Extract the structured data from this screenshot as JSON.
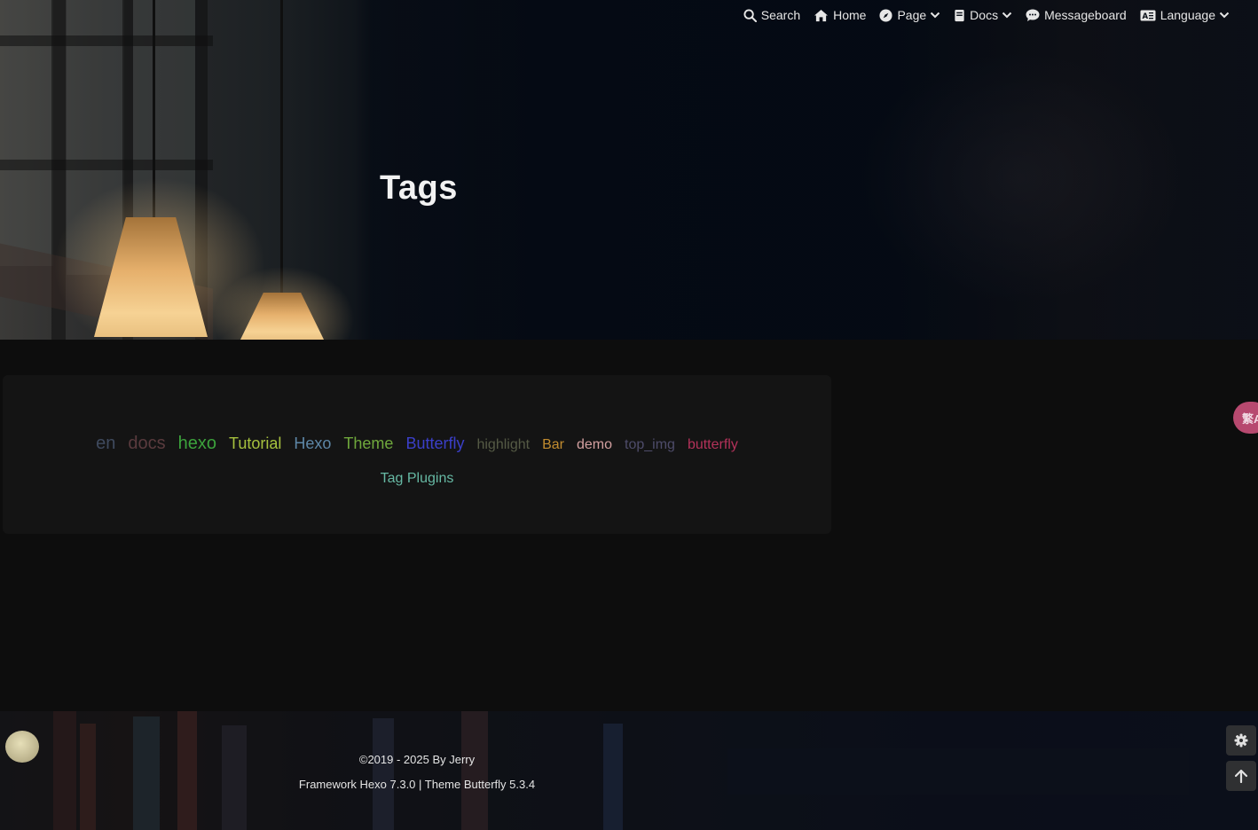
{
  "nav": {
    "items": [
      {
        "label": "Search",
        "icon": "search-icon"
      },
      {
        "label": "Home",
        "icon": "home-icon"
      },
      {
        "label": "Page",
        "icon": "compass-icon"
      },
      {
        "label": "Docs",
        "icon": "book-icon"
      },
      {
        "label": "Messageboard",
        "icon": "comment-icon"
      },
      {
        "label": "Language",
        "icon": "language-icon"
      }
    ]
  },
  "header": {
    "title": "Tags"
  },
  "tags": [
    {
      "label": "en",
      "color": "#3f4a5e"
    },
    {
      "label": "docs",
      "color": "#5a3b3e"
    },
    {
      "label": "hexo",
      "color": "#3ca23c"
    },
    {
      "label": "Tutorial",
      "color": "#a6c13e"
    },
    {
      "label": "Hexo",
      "color": "#5d86a6"
    },
    {
      "label": "Theme",
      "color": "#6fa83c"
    },
    {
      "label": "Butterfly",
      "color": "#3b3fc9"
    },
    {
      "label": "highlight",
      "color": "#555a45"
    },
    {
      "label": "Bar",
      "color": "#c28c2f"
    },
    {
      "label": "demo",
      "color": "#d3a0a0"
    },
    {
      "label": "top_img",
      "color": "#4e4c6a"
    },
    {
      "label": "butterfly",
      "color": "#b3325a"
    },
    {
      "label": "Tag Plugins",
      "color": "#66b8a3"
    }
  ],
  "translate_button": {
    "label": "繁A"
  },
  "footer": {
    "copyright": "©2019 - 2025 By Jerry",
    "framework": "Framework Hexo 7.3.0 | Theme Butterfly 5.3.4"
  },
  "side_buttons": [
    {
      "icon": "gear-icon"
    },
    {
      "icon": "arrow-up-icon"
    }
  ]
}
